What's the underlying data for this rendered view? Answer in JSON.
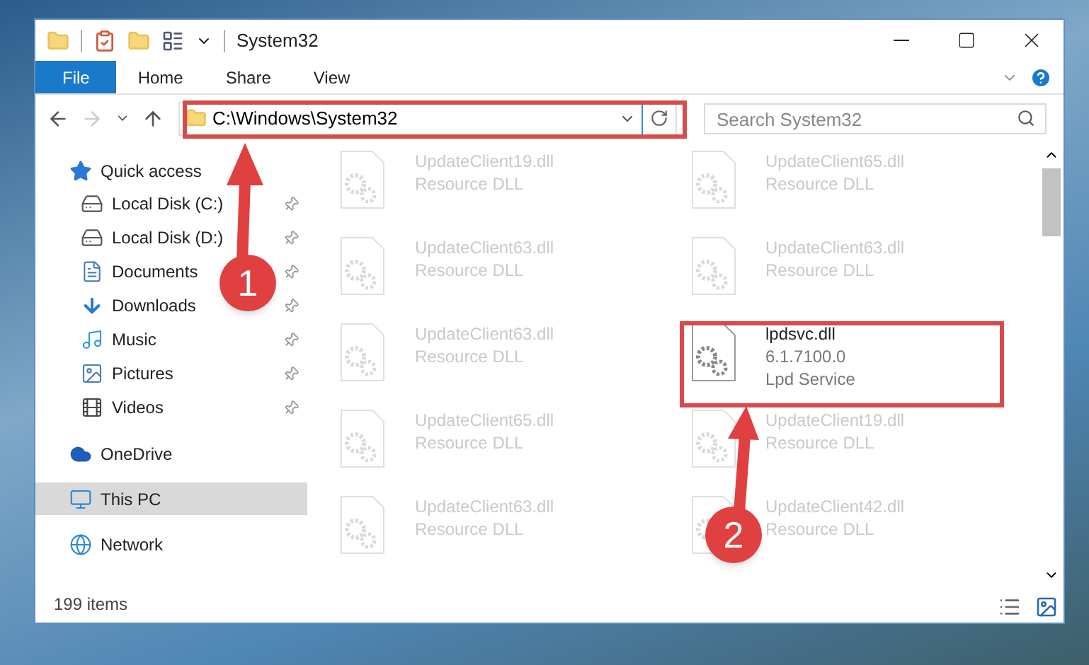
{
  "window": {
    "title": "System32"
  },
  "ribbon": {
    "tabs": [
      {
        "label": "File",
        "selected": true
      },
      {
        "label": "Home",
        "selected": false
      },
      {
        "label": "Share",
        "selected": false
      },
      {
        "label": "View",
        "selected": false
      }
    ]
  },
  "address_bar": {
    "path": "C:\\Windows\\System32"
  },
  "search": {
    "placeholder": "Search System32"
  },
  "sidebar": {
    "items": [
      {
        "label": "Quick access",
        "selected": false,
        "children": [
          {
            "label": "Local Disk (C:)",
            "pinned": true
          },
          {
            "label": "Local Disk (D:)",
            "pinned": true
          },
          {
            "label": "Documents",
            "pinned": true
          },
          {
            "label": "Downloads",
            "pinned": true
          },
          {
            "label": "Music",
            "pinned": true
          },
          {
            "label": "Pictures",
            "pinned": true
          },
          {
            "label": "Videos",
            "pinned": true
          }
        ]
      },
      {
        "label": "OneDrive",
        "selected": false
      },
      {
        "label": "This PC",
        "selected": true
      },
      {
        "label": "Network",
        "selected": false
      }
    ]
  },
  "files": [
    {
      "name": "UpdateClient19.dll",
      "lines": [
        "Resource DLL"
      ],
      "highlighted": false
    },
    {
      "name": "UpdateClient65.dll",
      "lines": [
        "Resource DLL"
      ],
      "highlighted": false
    },
    {
      "name": "UpdateClient63.dll",
      "lines": [
        "Resource DLL"
      ],
      "highlighted": false
    },
    {
      "name": "UpdateClient63.dll",
      "lines": [
        "Resource DLL"
      ],
      "highlighted": false
    },
    {
      "name": "UpdateClient63.dll",
      "lines": [
        "Resource DLL"
      ],
      "highlighted": false
    },
    {
      "name": "lpdsvc.dll",
      "lines": [
        "6.1.7100.0",
        "Lpd Service"
      ],
      "highlighted": true
    },
    {
      "name": "UpdateClient65.dll",
      "lines": [
        "Resource DLL"
      ],
      "highlighted": false
    },
    {
      "name": "UpdateClient19.dll",
      "lines": [
        "Resource DLL"
      ],
      "highlighted": false
    },
    {
      "name": "UpdateClient63.dll",
      "lines": [
        "Resource DLL"
      ],
      "highlighted": false
    },
    {
      "name": "UpdateClient42.dll",
      "lines": [
        "Resource DLL"
      ],
      "highlighted": false
    }
  ],
  "status_bar": {
    "item_count": "199 items"
  },
  "annotations": [
    {
      "label": "1"
    },
    {
      "label": "2"
    }
  ]
}
